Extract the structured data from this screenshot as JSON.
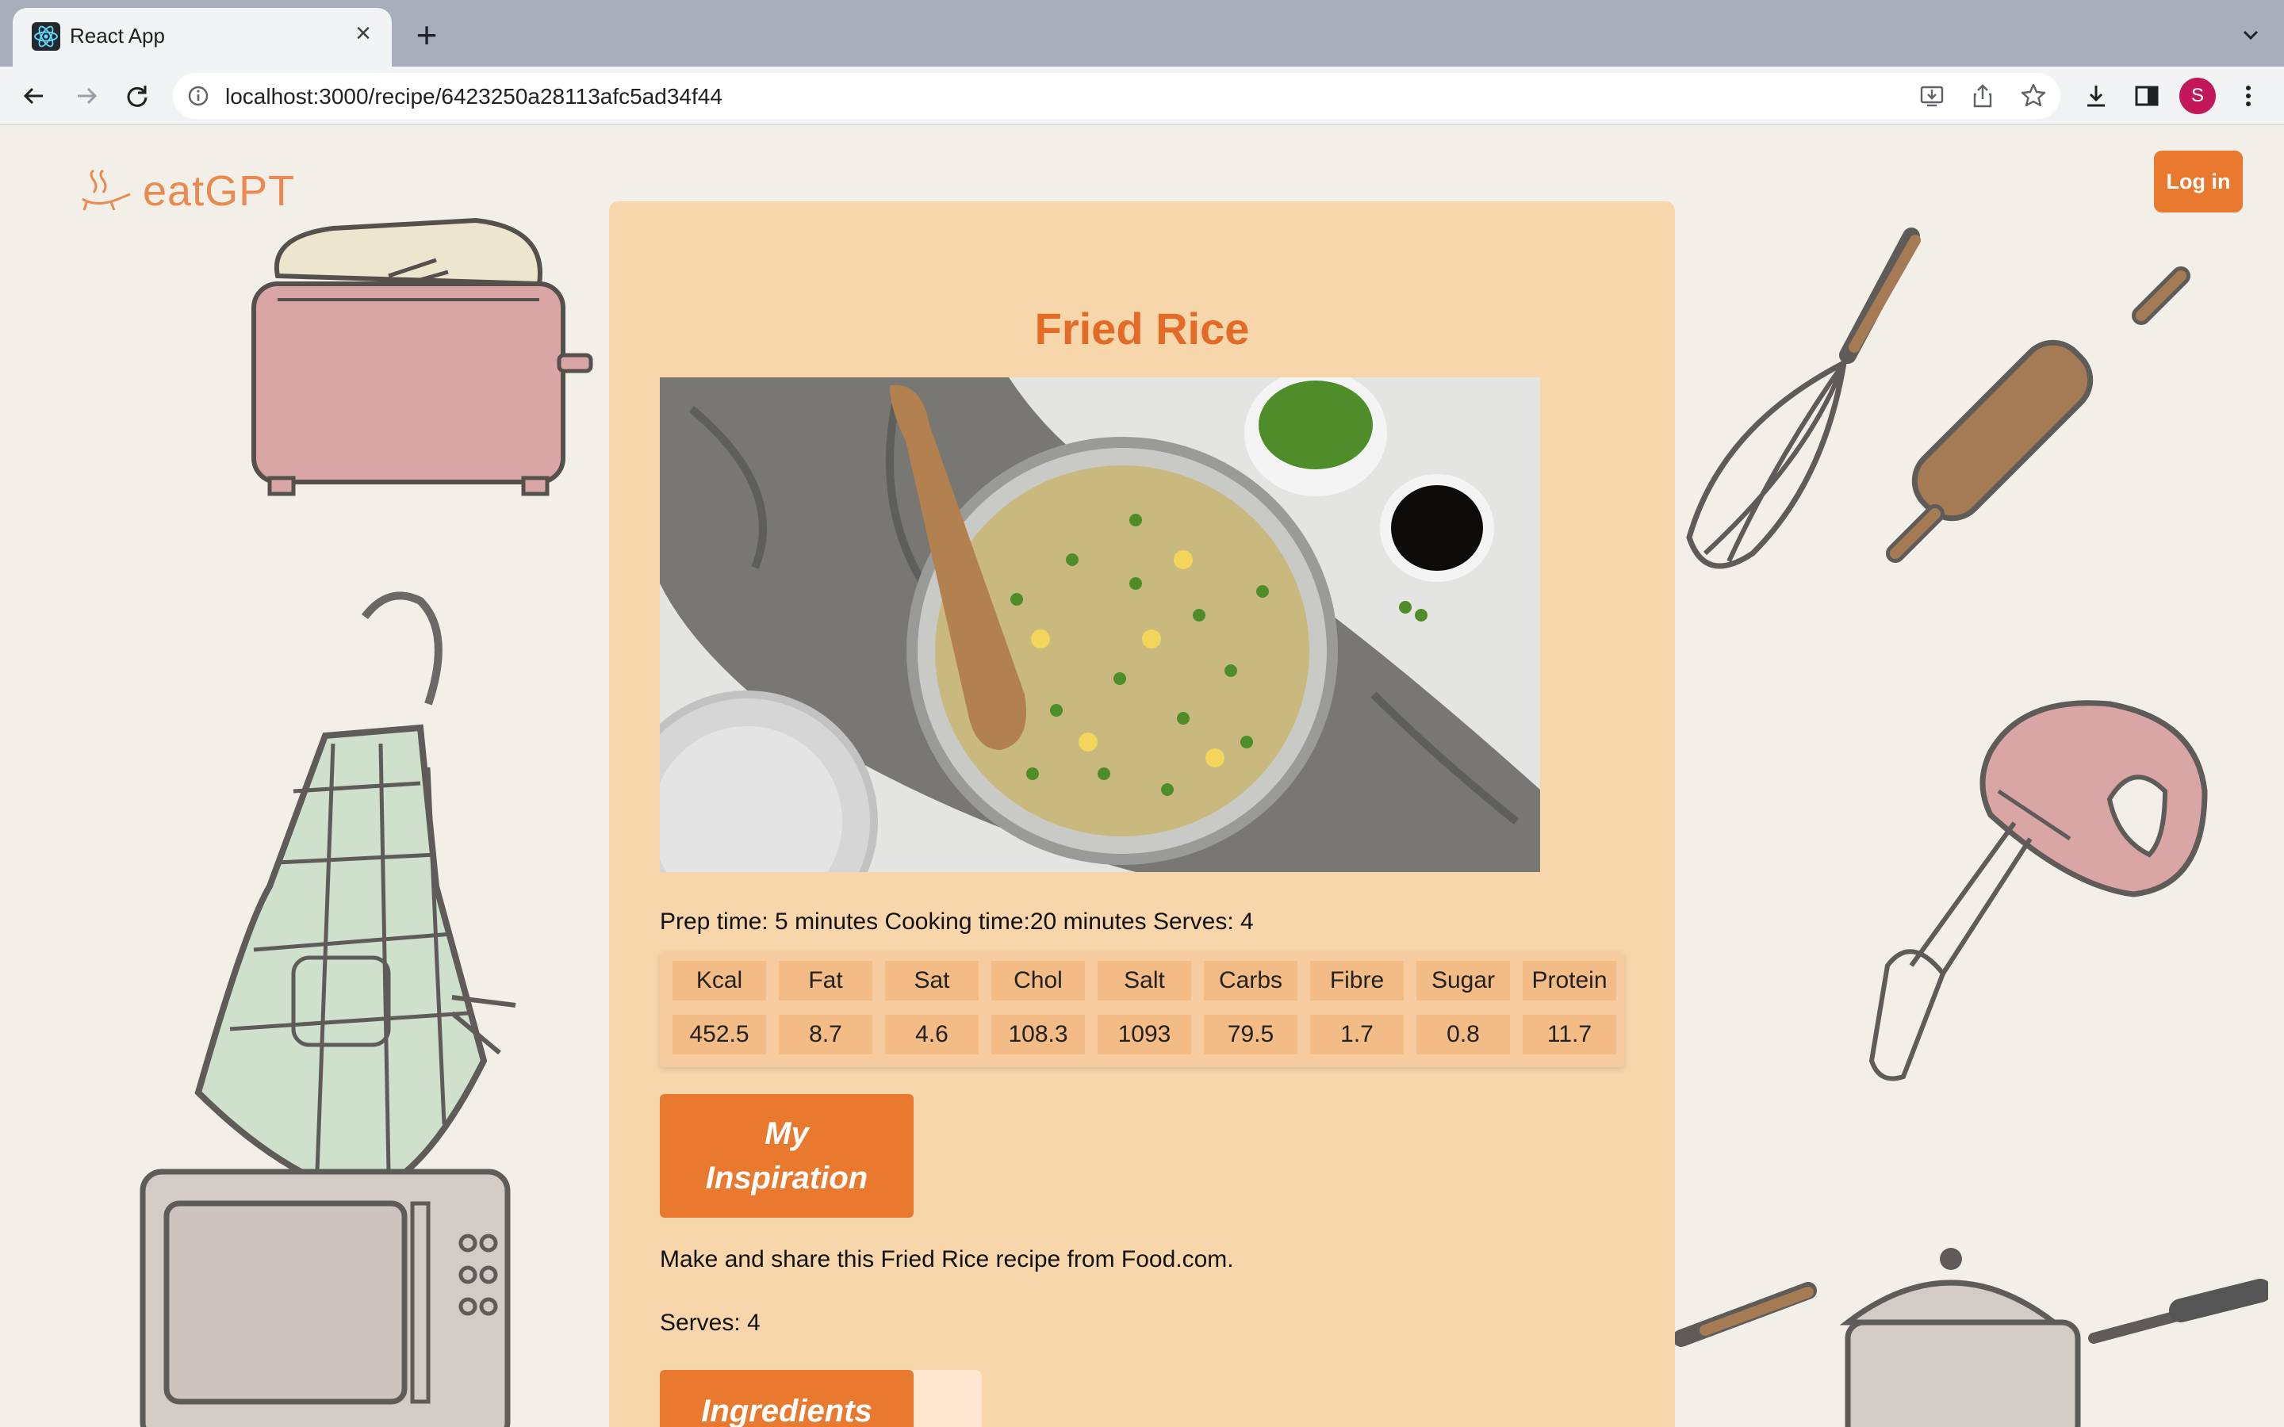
{
  "browser": {
    "tab_title": "React App",
    "url": "localhost:3000/recipe/6423250a28113afc5ad34f44",
    "profile_initial": "S",
    "favicon": "react-icon"
  },
  "header": {
    "logo_text": "eatGPT",
    "login_label": "Log in"
  },
  "recipe": {
    "title": "Fried Rice",
    "image_alt": "Fried rice in a pan with a wooden spoon, peas and soy sauce",
    "meta": "Prep time: 5 minutes Cooking time:20 minutes Serves: 4",
    "nutrition_headers": [
      "Kcal",
      "Fat",
      "Sat",
      "Chol",
      "Salt",
      "Carbs",
      "Fibre",
      "Sugar",
      "Protein"
    ],
    "nutrition_values": [
      "452.5",
      "8.7",
      "4.6",
      "108.3",
      "1093",
      "79.5",
      "1.7",
      "0.8",
      "11.7"
    ],
    "inspiration_label": "My Inspiration",
    "description": "Make and share this Fried Rice recipe from Food.com.",
    "serves": "Serves: 4",
    "ingredients_label": "Ingredients"
  },
  "colors": {
    "accent": "#e8792f",
    "title": "#e36a27",
    "card": "#f8d6ab",
    "nutrition_cell": "#f3bb85"
  }
}
